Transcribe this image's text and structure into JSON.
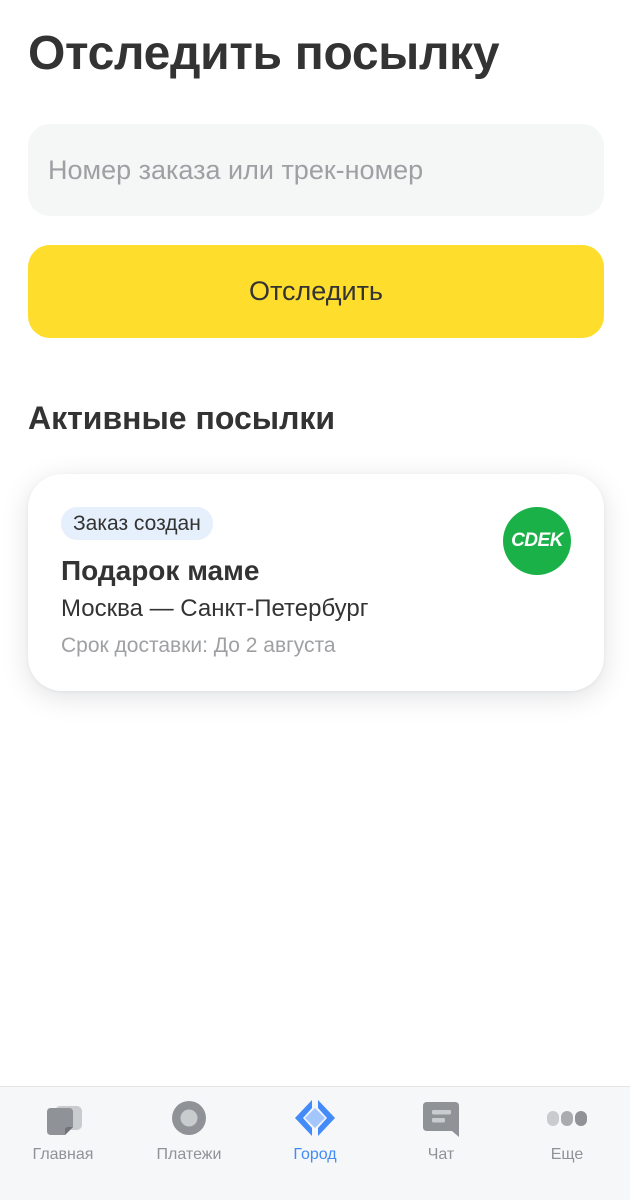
{
  "header": {
    "title": "Отследить посылку"
  },
  "search": {
    "placeholder": "Номер заказа или трек-номер",
    "value": ""
  },
  "track_button": {
    "label": "Отследить",
    "color": "#ffdd2d"
  },
  "active_parcels": {
    "title": "Активные посылки",
    "items": [
      {
        "status": "Заказ создан",
        "name": "Подарок маме",
        "route": "Москва — Санкт-Петербург",
        "eta": "Срок доставки: До 2 августа",
        "carrier_logo_text": "CDEK",
        "carrier_color": "#1ab248"
      }
    ]
  },
  "tab_bar": {
    "active_color": "#428bf9",
    "inactive_color": "#8f9397",
    "items": [
      {
        "label": "Главная",
        "icon": "card-icon",
        "active": false
      },
      {
        "label": "Платежи",
        "icon": "circle-icon",
        "active": false
      },
      {
        "label": "Город",
        "icon": "city-diamond-icon",
        "active": true
      },
      {
        "label": "Чат",
        "icon": "chat-icon",
        "active": false
      },
      {
        "label": "Еще",
        "icon": "more-dots-icon",
        "active": false
      }
    ]
  }
}
